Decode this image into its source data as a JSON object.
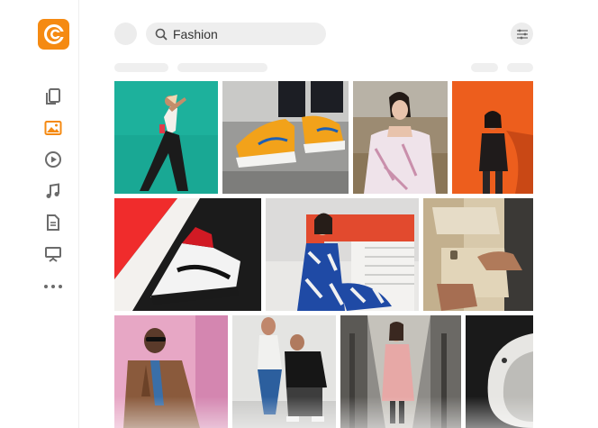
{
  "search": {
    "value": "Fashion"
  },
  "sidebar": {
    "items": [
      {
        "icon": "documents-icon"
      },
      {
        "icon": "images-icon",
        "active": true
      },
      {
        "icon": "video-play-icon"
      },
      {
        "icon": "music-note-icon"
      },
      {
        "icon": "document-icon"
      },
      {
        "icon": "presentation-icon"
      },
      {
        "icon": "more-icon"
      }
    ]
  },
  "colors": {
    "accent": "#f58a12",
    "icon": "#6b6b6b"
  }
}
